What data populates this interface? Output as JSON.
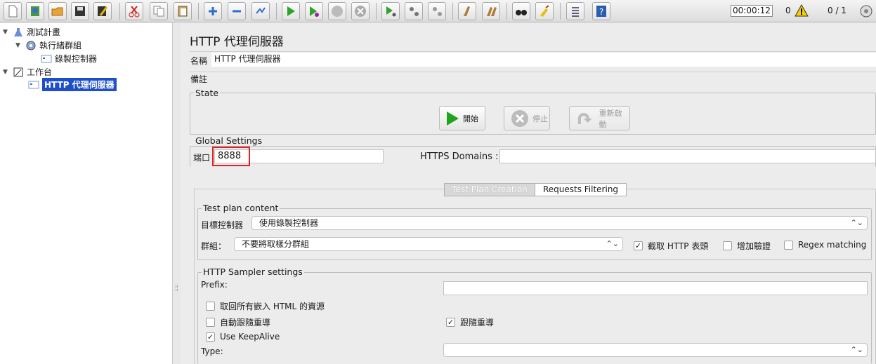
{
  "toolbar": {
    "timer": "00:00:12",
    "warnings": "0",
    "threads": "0 / 1"
  },
  "tree": {
    "items": [
      {
        "label": "測試計畫"
      },
      {
        "label": "執行緒群組"
      },
      {
        "label": "錄製控制器"
      },
      {
        "label": "工作台"
      },
      {
        "label": "HTTP 代理伺服器"
      }
    ]
  },
  "panel": {
    "title": "HTTP 代理伺服器",
    "name_label": "名稱",
    "name_value": "HTTP 代理伺服器",
    "comments_label": "備註",
    "state": {
      "legend": "State",
      "start": "開始",
      "stop": "停止",
      "restart": "重新啟動"
    },
    "global": {
      "legend": "Global Settings",
      "port_label": "端口",
      "port_value": "8888",
      "https_label": "HTTPS Domains :"
    },
    "tabs": [
      {
        "label": "Test Plan Creation"
      },
      {
        "label": "Requests Filtering"
      }
    ],
    "plan": {
      "legend": "Test plan content",
      "target_label": "目標控制器",
      "target_value": "使用錄製控制器",
      "group_label": "群組：",
      "group_value": "不要將取樣分群組",
      "capture_headers": "截取 HTTP 表頭",
      "add_assertions": "增加驗證",
      "regex": "Regex matching"
    },
    "sampler": {
      "legend": "HTTP Sampler settings",
      "prefix_label": "Prefix:",
      "retrieve": "取回所有嵌入 HTML 的資源",
      "auto_redirect": "自動跟隨重導",
      "follow_redirect": "跟隨重導",
      "keepalive": "Use KeepAlive",
      "type_label": "Type:"
    }
  }
}
